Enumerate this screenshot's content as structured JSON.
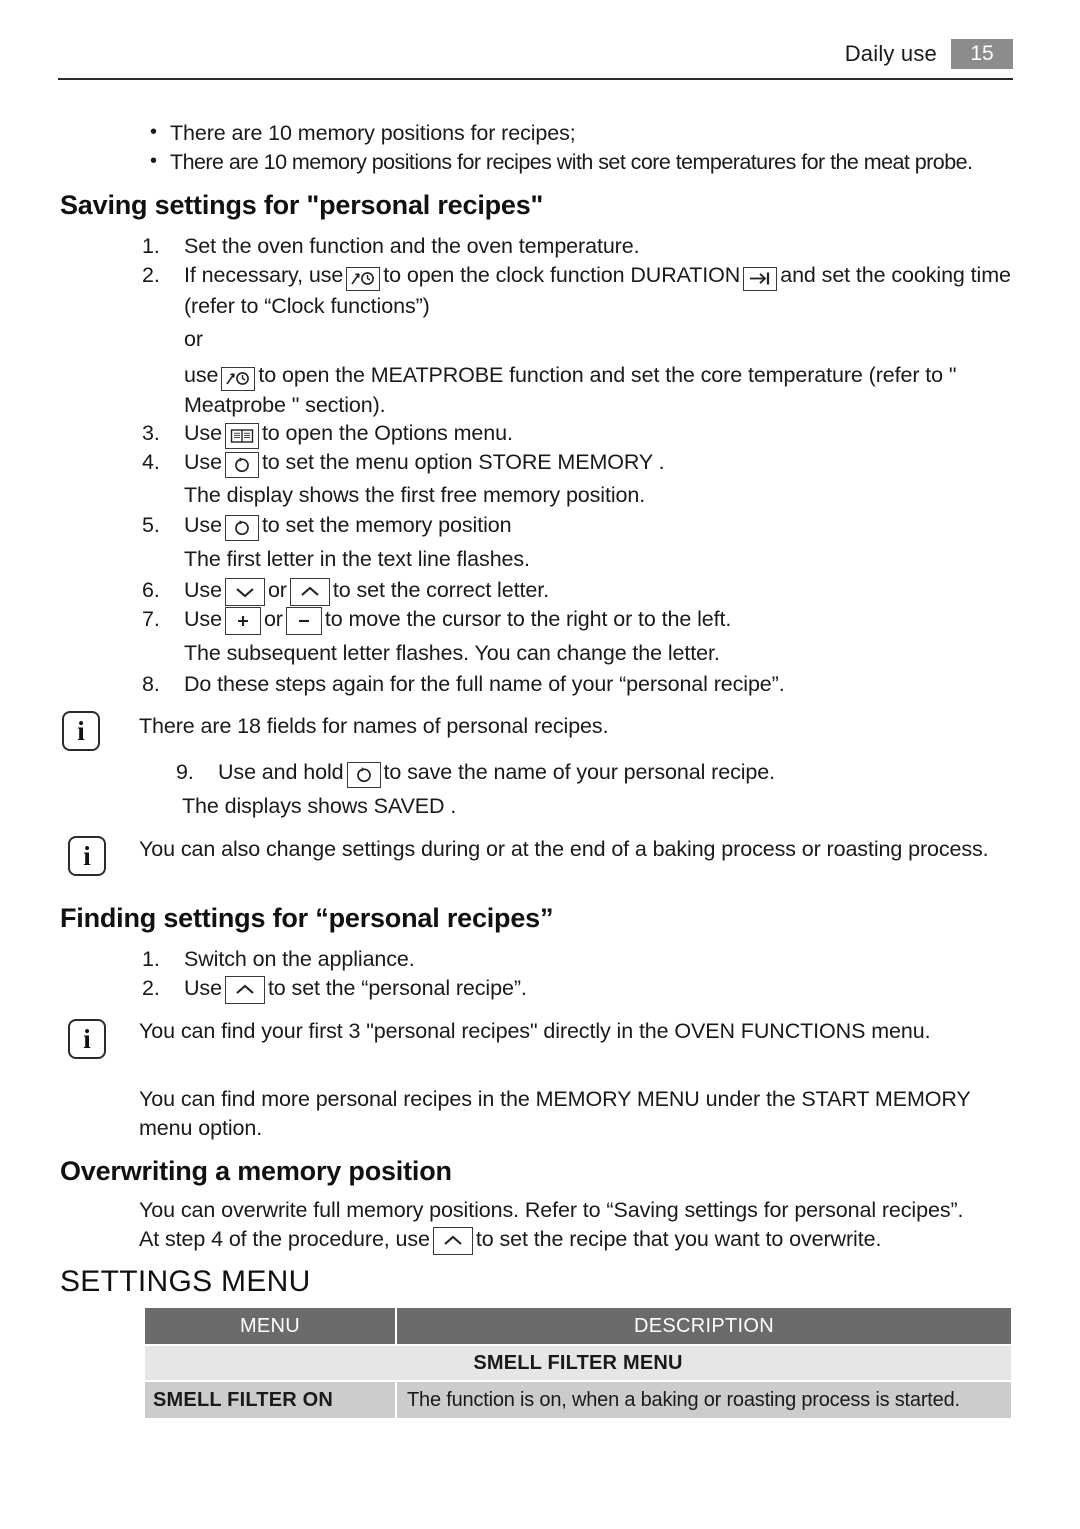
{
  "header": {
    "title": "Daily use",
    "page_number": "15"
  },
  "bullets": [
    "There are 10 memory positions for recipes;",
    "There are 10 memory positions for recipes with set core temperatures for the meat probe."
  ],
  "saving_section": {
    "heading": "Saving settings for \"personal recipes\"",
    "step1_num": "1.",
    "step1_text": "Set the oven function and the oven temperature.",
    "step2_num": "2.",
    "step2_a": "If necessary, use",
    "step2_b": "to open the clock function DURATION",
    "step2_c": "and set the cooking time (refer to “Clock functions”)",
    "or_text": "or",
    "meatprobe_a": "use",
    "meatprobe_b": "to open the MEATPROBE function and set the core temperature (refer to \" Meatprobe \" section).",
    "step3_num": "3.",
    "step3_a": "Use",
    "step3_b": "to open the Options menu.",
    "step4_num": "4.",
    "step4_a": "Use",
    "step4_b": "to set the menu option STORE MEMORY .",
    "note_after_4": "The display shows the first free memory position.",
    "step5_num": "5.",
    "step5_a": "Use",
    "step5_b": "to set the memory position",
    "note_after_5": "The first letter in the text line flashes.",
    "step6_num": "6.",
    "step6_a": "Use",
    "step6_or": "or",
    "step6_b": "to set the correct letter.",
    "step7_num": "7.",
    "step7_a": "Use",
    "step7_or": "or",
    "step7_b": "to move the cursor to the right or to the left.",
    "note_after_7": "The subsequent letter flashes. You can change the letter.",
    "step8_num": "8.",
    "step8_text": "Do these steps again for the full name of your “personal recipe”.",
    "info1": "There are 18 fields for names of personal recipes.",
    "step9_num": "9.",
    "step9_a": "Use and hold",
    "step9_b": "to save the name of your personal recipe.",
    "note_after_9": "The displays shows SAVED .",
    "info2": "You can also change settings during or at the end of a baking process or roasting process."
  },
  "finding_section": {
    "heading": "Finding settings for “personal recipes”",
    "step1_num": "1.",
    "step1_text": "Switch on the appliance.",
    "step2_num": "2.",
    "step2_a": "Use",
    "step2_b": "to set the “personal recipe”.",
    "info1": "You can find your first 3 \"personal recipes\" directly in the OVEN FUNCTIONS menu.",
    "para": "You can find more personal recipes in the MEMORY MENU under the START MEMORY menu option."
  },
  "overwriting_section": {
    "heading": "Overwriting a memory position",
    "line1": "You can overwrite full memory positions. Refer to “Saving settings for personal recipes”.",
    "line2_a": "At step 4 of the procedure, use",
    "line2_b": "to set the recipe that you want to overwrite."
  },
  "settings_menu": {
    "heading": "SETTINGS MENU",
    "columns": [
      "MENU",
      "DESCRIPTION"
    ],
    "section_row": "SMELL FILTER MENU",
    "rows": [
      {
        "menu": "SMELL FILTER ON",
        "description": "The function is on, when a baking or roasting process is started."
      }
    ]
  },
  "icons": {
    "clock_probe": "clock-arrow-icon",
    "duration": "duration-arrow-icon",
    "options_book": "options-book-icon",
    "select_ok": "select-ok-icon",
    "chev_down": "chevron-down-icon",
    "chev_up": "chevron-up-icon",
    "plus": "plus-icon",
    "minus": "minus-icon",
    "info": "info-icon"
  },
  "colors": {
    "table_header_bg": "#6b6b6b",
    "table_section_bg": "#e6e6e6",
    "table_row_bg": "#cccccc",
    "page_badge_bg": "#8c8c8c",
    "text": "#1a1a1a"
  }
}
